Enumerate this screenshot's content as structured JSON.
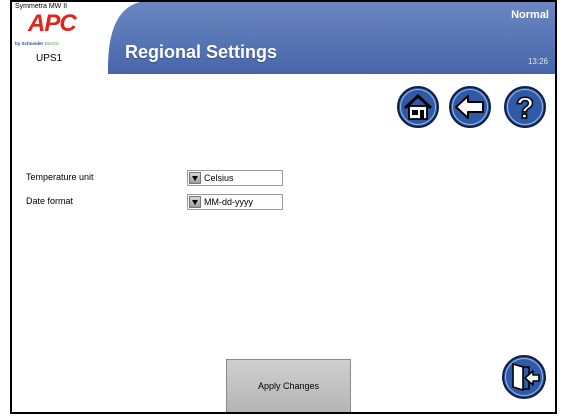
{
  "header": {
    "model": "Symmetra MW II",
    "brand": "APC",
    "maker": "by Schneider",
    "maker_suffix": "Electric",
    "device": "UPS1",
    "title": "Regional Settings",
    "status": "Normal",
    "time": "13:26"
  },
  "nav": {
    "home_icon": "home-icon",
    "back_icon": "back-arrow-icon",
    "help_icon": "help-icon"
  },
  "form": {
    "temperature_label": "Temperature unit",
    "temperature_value": "Celsius",
    "date_label": "Date format",
    "date_value": "MM-dd-yyyy"
  },
  "actions": {
    "apply_label": "Apply Changes",
    "exit_icon": "exit-door-icon"
  },
  "colors": {
    "header_blue": "#5573b3",
    "button_blue": "#2e5aa8",
    "apc_red": "#e2231a"
  }
}
